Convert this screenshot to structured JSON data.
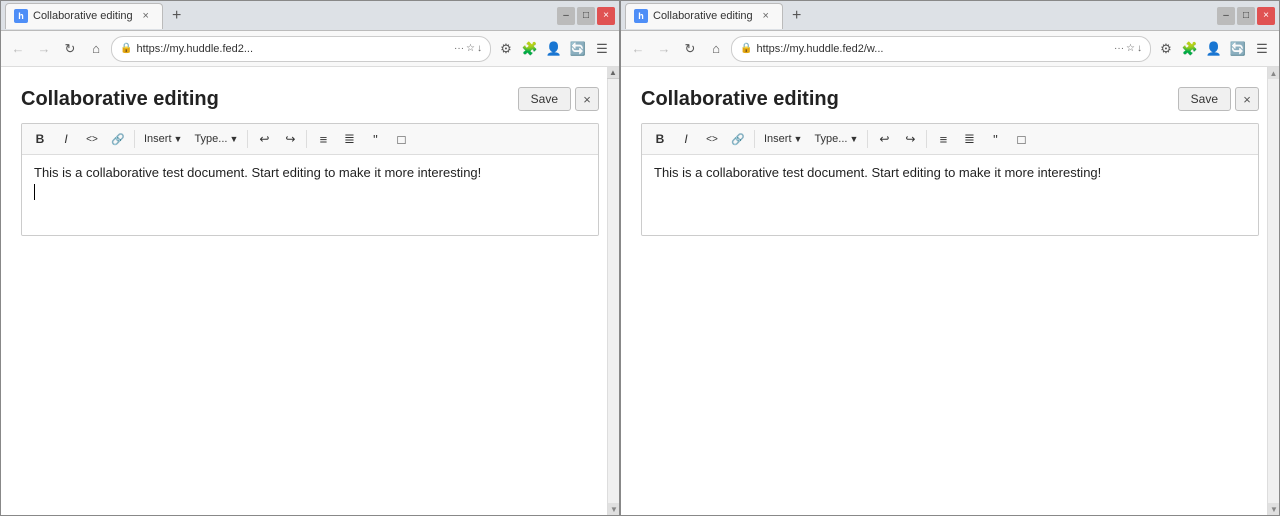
{
  "window1": {
    "tab": {
      "icon": "h",
      "title": "Collaborative editing",
      "close_label": "×"
    },
    "new_tab_label": "+",
    "window_controls": {
      "minimize": "–",
      "maximize": "□",
      "close": "×"
    },
    "nav": {
      "back_label": "←",
      "forward_label": "→",
      "reload_label": "↻",
      "home_label": "⌂",
      "address": "https://my.huddle.fed2...",
      "menu_label": "···",
      "bookmark_label": "☆",
      "download_label": "↓",
      "tools_label": "⚙",
      "extensions_label": "☰"
    },
    "doc": {
      "title": "Collaborative editing",
      "save_label": "Save",
      "close_label": "×",
      "toolbar": {
        "bold": "B",
        "italic": "I",
        "code": "<>",
        "link": "🔗",
        "insert": "Insert",
        "type": "Type...",
        "undo": "↩",
        "redo": "↪",
        "list_ul": "☰",
        "list_ol": "☰",
        "quote": "❝",
        "layout": "□"
      },
      "content": "This is a collaborative test document. Start editing to make it more interesting!",
      "content2": ""
    }
  },
  "window2": {
    "tab": {
      "icon": "h",
      "title": "Collaborative editing",
      "close_label": "×"
    },
    "new_tab_label": "+",
    "window_controls": {
      "minimize": "–",
      "maximize": "□",
      "close": "×"
    },
    "nav": {
      "back_label": "←",
      "forward_label": "→",
      "reload_label": "↻",
      "home_label": "⌂",
      "address": "https://my.huddle.fed2/w...",
      "menu_label": "···",
      "bookmark_label": "☆",
      "download_label": "↓",
      "tools_label": "⚙",
      "extensions_label": "☰"
    },
    "doc": {
      "title": "Collaborative editing",
      "save_label": "Save",
      "close_label": "×",
      "toolbar": {
        "bold": "B",
        "italic": "I",
        "code": "<>",
        "link": "🔗",
        "insert": "Insert",
        "type": "Type...",
        "undo": "↩",
        "redo": "↪",
        "list_ul": "☰",
        "list_ol": "☰",
        "quote": "❝",
        "layout": "□"
      },
      "content": "This is a collaborative test document. Start editing to make it more interesting!"
    }
  }
}
